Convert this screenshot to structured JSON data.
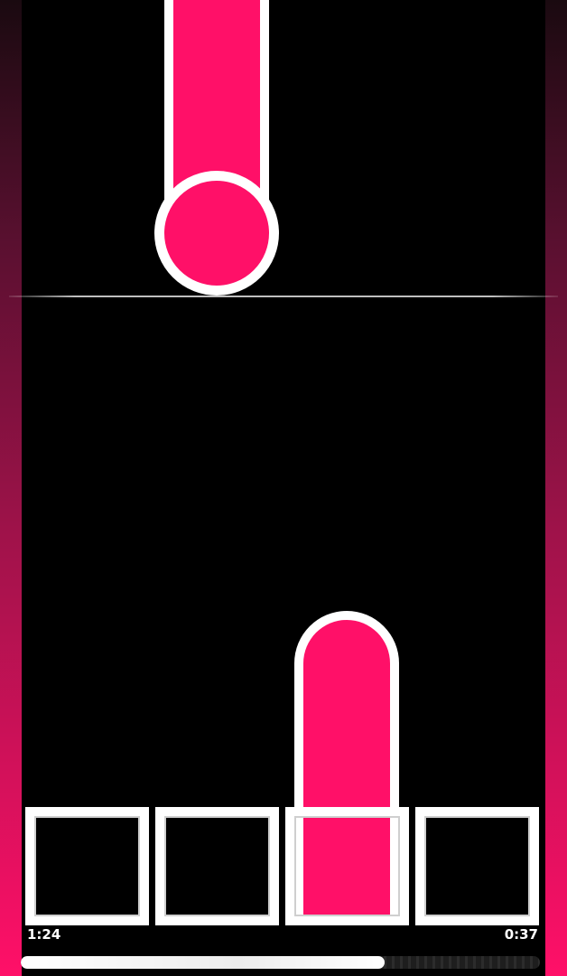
{
  "theme": {
    "accent_color": "#ff1068",
    "outline_color": "#ffffff",
    "background_color": "#000000"
  },
  "lanes": [
    "lane-1",
    "lane-2",
    "lane-3",
    "lane-4"
  ],
  "notes": [
    {
      "type": "hold-falling",
      "lane": 2
    },
    {
      "type": "hold-active",
      "lane": 3
    }
  ],
  "hud": {
    "elapsed_time": "1:24",
    "remaining_time": "0:37",
    "progress": 0.7
  }
}
